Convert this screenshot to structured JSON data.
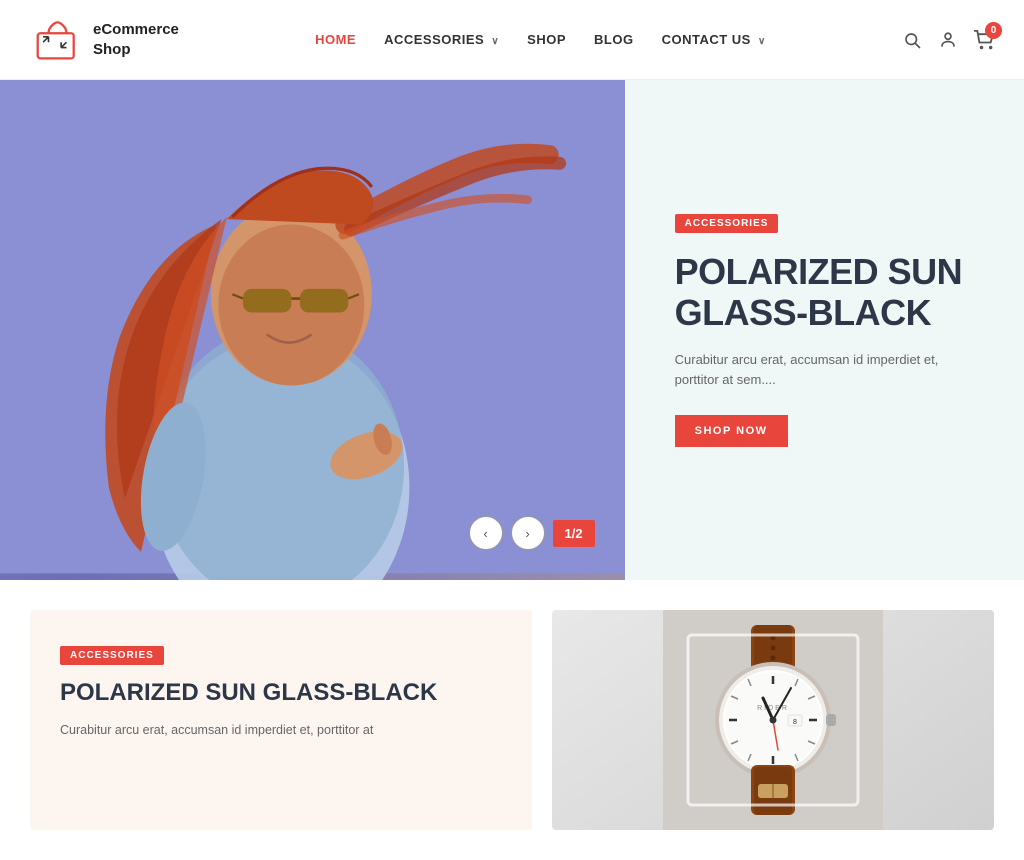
{
  "header": {
    "logo_text_line1": "eCommerce",
    "logo_text_line2": "Shop",
    "nav": [
      {
        "label": "HOME",
        "active": true,
        "has_dropdown": false
      },
      {
        "label": "ACCESSORIES",
        "active": false,
        "has_dropdown": true
      },
      {
        "label": "SHOP",
        "active": false,
        "has_dropdown": false
      },
      {
        "label": "BLOG",
        "active": false,
        "has_dropdown": false
      },
      {
        "label": "CONTACT US",
        "active": false,
        "has_dropdown": true
      }
    ],
    "cart_count": "0"
  },
  "hero": {
    "category_badge": "ACCESSORIES",
    "title_line1": "POLARIZED SUN",
    "title_line2": "GLASS-BLACK",
    "description": "Curabitur arcu erat, accumsan id imperdiet et, porttitor at sem....",
    "cta_label": "SHOP NOW",
    "counter": "1/2",
    "prev_label": "‹",
    "next_label": "›"
  },
  "cards": [
    {
      "category_badge": "ACCESSORIES",
      "title": "POLARIZED SUN GLASS-BLACK",
      "description": "Curabitur arcu erat, accumsan id imperdiet et, porttitor at"
    },
    {
      "type": "image",
      "alt": "Watch product image"
    }
  ],
  "icons": {
    "search": "🔍",
    "user": "👤",
    "cart": "🛒",
    "chevron": "∨",
    "arrow_left": "‹",
    "arrow_right": "›"
  }
}
